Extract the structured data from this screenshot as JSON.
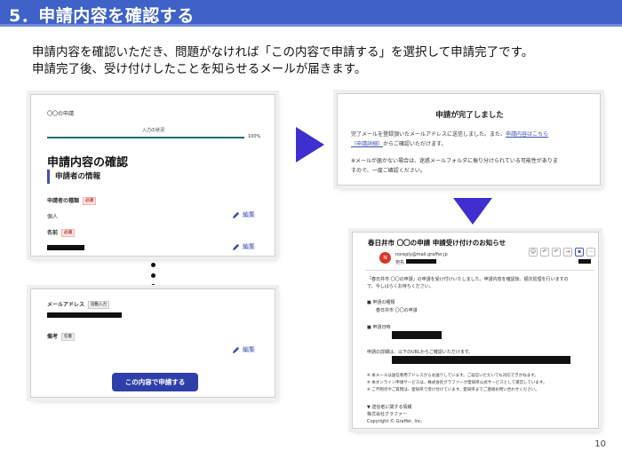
{
  "header": {
    "title": "5．申請内容を確認する"
  },
  "intro": {
    "line1": "申請内容を確認いただき、問題がなければ「この内容で申請する」を選択して申請完了です。",
    "line2": "申請完了後、受け付けしたことを知らせるメールが届きます。"
  },
  "form_panel": {
    "app_name": "〇〇の申請",
    "progress_label": "入力の状況",
    "progress_value": "100%",
    "progress_fraction": 1.0,
    "heading": "申請内容の確認",
    "section": "申請者の情報",
    "field1_label": "申請者の種類",
    "field1_tag": "必須",
    "field1_value": "個人",
    "field2_label": "名前",
    "field2_tag": "必須",
    "edit_label": "編集"
  },
  "complete_panel": {
    "title": "申請が完了しました",
    "text1a": "完了メールを登録頂いたメールアドレスに送信しました。また、",
    "text1_link": "申請内容はこちら",
    "text1_link2": "（申請詳細）",
    "text1b": "からご確認いただけます。",
    "text2a": "※メールが届かない場合は、迷惑メールフォルダに振り分けられている可能性がありま",
    "text2b": "すので、一度ご確認ください。"
  },
  "form_panel_bottom": {
    "email_label": "メールアドレス",
    "email_tag": "自動入力",
    "note_label": "備考",
    "note_tag": "任意",
    "edit_label": "編集",
    "submit_label": "この内容で申請する"
  },
  "mail_panel": {
    "subject": "春日井市 〇〇の申請 申請受け付けのお知らせ",
    "avatar_letter": "N",
    "sender": "noreply@mail.graffer.jp",
    "to_label": "宛先",
    "body1": "「春日井市 〇〇の申請」の申請を受け付けいたしました。申請内容を確認後、順次処理を行いますの",
    "body1b": "で、今しばらくお待ちください。",
    "item1_label": "■ 申請の種類",
    "item1_value": "春日井市 〇〇の申請",
    "item2_label": "■ 申請日時",
    "detail_text": "申請の詳細は、以下のURLからご確認いただけます。",
    "note1": "※ 本メールは送信専用アドレスからお送りしています。ご返信いただいても対応できかねます。",
    "note2": "※ 本オンライン申請サービスは、株式会社グラファーが愛知県公式サービスとして運営しています。",
    "note3": "※ ご不明点やご質問は、愛知県で受け付けています。愛知県までご連絡お問い合わせください。",
    "footer1": "▼ 送信者に関する情報",
    "footer2": "株式会社グラファー",
    "footer3": "Copyright © Graffer, Inc."
  },
  "page_number": "10",
  "colors": {
    "header": "#3f62c8",
    "arrow": "#3f2fd0",
    "button": "#2f3fa8",
    "progress": "#1f6e6a"
  }
}
